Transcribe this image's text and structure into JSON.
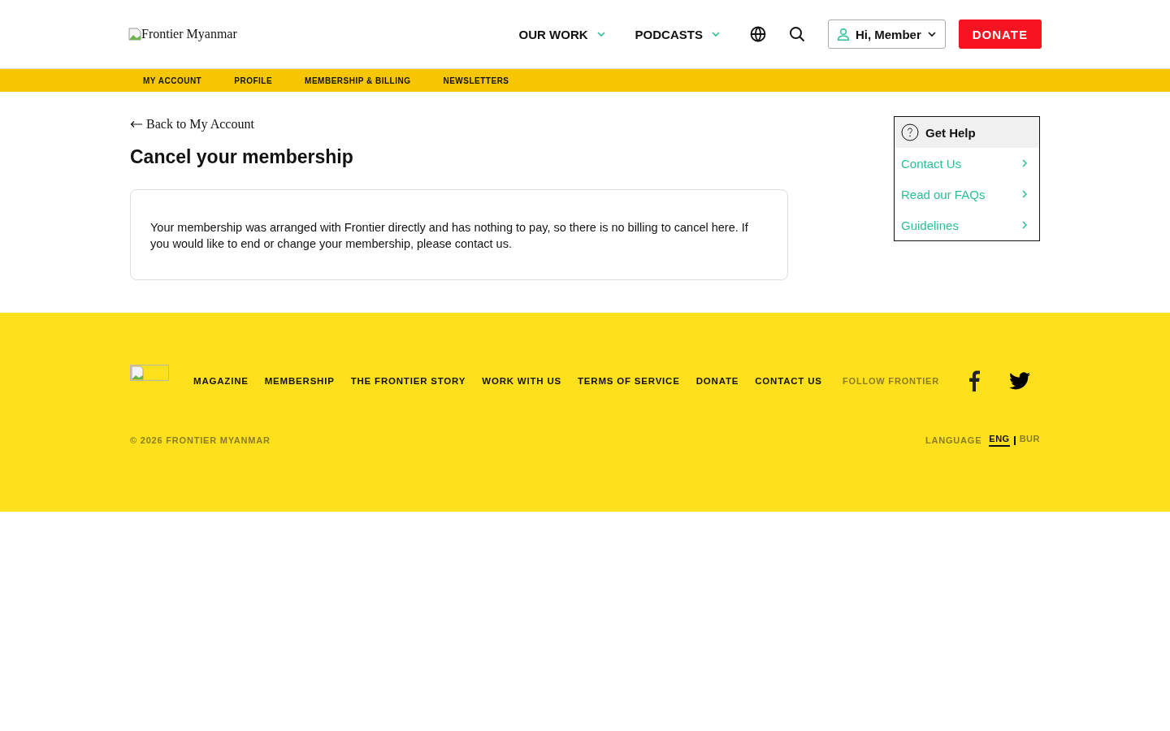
{
  "header": {
    "logo_alt": "Frontier Myanmar",
    "nav": [
      {
        "label": "OUR WORK"
      },
      {
        "label": "PODCASTS"
      }
    ],
    "account_button": "Hi, Member",
    "donate_button": "DONATE"
  },
  "subnav": [
    {
      "label": "MY ACCOUNT"
    },
    {
      "label": "PROFILE"
    },
    {
      "label": "MEMBERSHIP & BILLING"
    },
    {
      "label": "NEWSLETTERS"
    }
  ],
  "back_link": "Back to My Account",
  "title": "Cancel your membership",
  "message": "Your membership was arranged with Frontier directly and has nothing to pay, so there is no billing to cancel here. If you would like to end or change your membership, please contact us.",
  "help": {
    "title": "Get Help",
    "links": [
      "Contact Us",
      "Read our FAQs",
      "Guidelines"
    ]
  },
  "footer": {
    "links": [
      "MAGAZINE",
      "MEMBERSHIP",
      "THE FRONTIER STORY",
      "WORK WITH US",
      "TERMS OF SERVICE",
      "DONATE",
      "CONTACT US"
    ],
    "follow_label": "FOLLOW FRONTIER",
    "copyright": "© 2026 FRONTIER MYANMAR",
    "language_label": "LANGUAGE",
    "languages": [
      {
        "label": "ENG",
        "selected": true
      },
      {
        "label": "BUR",
        "selected": false
      }
    ]
  }
}
